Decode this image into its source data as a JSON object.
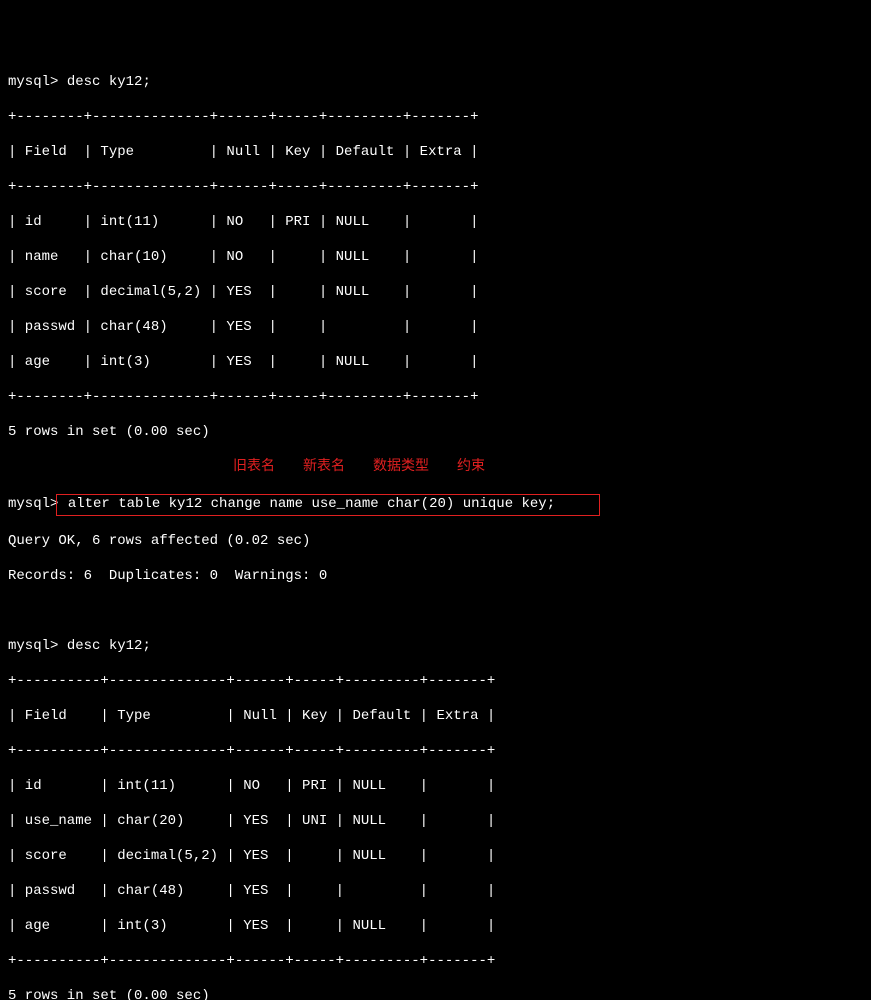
{
  "prompt": "mysql>",
  "commands": {
    "desc1": "desc ky12;",
    "desc2": "desc ky12;",
    "alter_prefix": "mysql>",
    "alter_cmd": " alter table ky12 change name use_name char(20) unique key;"
  },
  "results": {
    "rows_msg": "5 rows in set (0.00 sec)",
    "query_ok": "Query OK, 6 rows affected (0.02 sec)",
    "records": "Records: 6  Duplicates: 0  Warnings: 0"
  },
  "labels": {
    "old_table": "旧表名",
    "new_table": "新表名",
    "data_type": "数据类型",
    "constraint": "约束"
  },
  "table1": {
    "border": "+--------+--------------+------+-----+---------+-------+",
    "header": "| Field  | Type         | Null | Key | Default | Extra |",
    "rows": [
      "| id     | int(11)      | NO   | PRI | NULL    |       |",
      "| name   | char(10)     | NO   |     | NULL    |       |",
      "| score  | decimal(5,2) | YES  |     | NULL    |       |",
      "| passwd | char(48)     | YES  |     |         |       |",
      "| age    | int(3)       | YES  |     | NULL    |       |"
    ]
  },
  "table2": {
    "border": "+----------+--------------+------+-----+---------+-------+",
    "header": "| Field    | Type         | Null | Key | Default | Extra |",
    "rows": [
      "| id       | int(11)      | NO   | PRI | NULL    |       |",
      "| use_name | char(20)     | YES  | UNI | NULL    |       |",
      "| score    | decimal(5,2) | YES  |     | NULL    |       |",
      "| passwd   | char(48)     | YES  |     |         |       |",
      "| age      | int(3)       | YES  |     | NULL    |       |"
    ]
  }
}
